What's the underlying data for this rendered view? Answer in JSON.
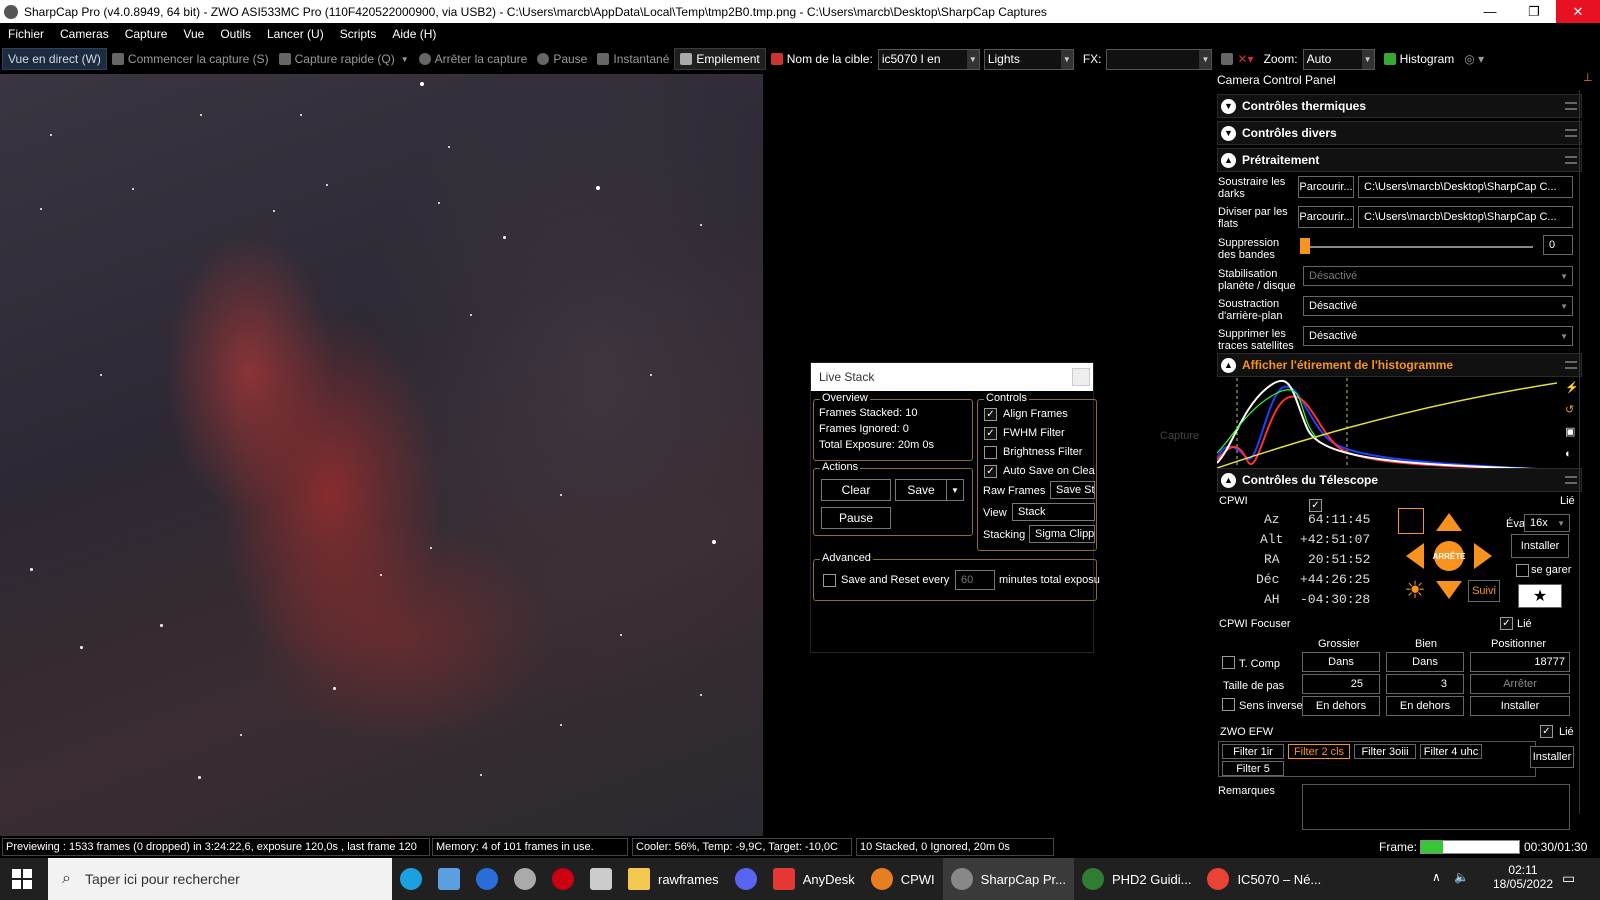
{
  "window": {
    "title": "SharpCap Pro (v4.0.8949, 64 bit) - ZWO ASI533MC Pro (110F420522000900, via USB2) - C:\\Users\\marcb\\AppData\\Local\\Temp\\tmp2B0.tmp.png - C:\\Users\\marcb\\Desktop\\SharpCap Captures",
    "minimize": "—",
    "maximize": "❐",
    "close": "✕"
  },
  "menu": [
    "Fichier",
    "Cameras",
    "Capture",
    "Vue",
    "Outils",
    "Lancer (U)",
    "Scripts",
    "Aide (H)"
  ],
  "toolbar": {
    "live_view": "Vue en direct (W)",
    "start_capture": "Commencer la capture (S)",
    "quick_capture": "Capture rapide (Q)",
    "stop_capture": "Arrêter la capture",
    "pause": "Pause",
    "snapshot": "Instantané",
    "stacking": "Empilement",
    "target_label": "Nom de la cible:",
    "target_value": "ic5070 I en",
    "frame_type": "Lights",
    "fx_label": "FX:",
    "zoom_label": "Zoom:",
    "zoom_value": "Auto",
    "histogram": "Histogram"
  },
  "live_stack": {
    "title": "Live Stack",
    "overview_label": "Overview",
    "frames_stacked": "Frames Stacked:  10",
    "frames_ignored": "Frames Ignored:  0",
    "total_exposure": "Total Exposure:   20m 0s",
    "actions_label": "Actions",
    "clear": "Clear",
    "save": "Save",
    "pause": "Pause",
    "controls_label": "Controls",
    "align_frames": "Align Frames",
    "fwhm_filter": "FWHM Filter",
    "brightness_filter": "Brightness Filter",
    "auto_save": "Auto Save on Clea",
    "raw_frames_label": "Raw Frames",
    "raw_frames_value": "Save St",
    "view_label": "View",
    "view_value": "Stack",
    "stacking_label": "Stacking",
    "stacking_value": "Sigma Clipp",
    "advanced_label": "Advanced",
    "save_reset": "Save and Reset every",
    "save_reset_minutes": "60",
    "save_reset_suffix": "minutes total exposu"
  },
  "panel": {
    "title": "Camera Control Panel",
    "thermal": "Contrôles thermiques",
    "misc": "Contrôles divers",
    "preprocessing": "Prétraitement",
    "subtract_darks": "Soustraire les darks",
    "divide_flats": "Diviser par les flats",
    "browse": "Parcourir...",
    "darks_path": "C:\\Users\\marcb\\Desktop\\SharpCap C...",
    "flats_path": "C:\\Users\\marcb\\Desktop\\SharpCap C...",
    "banding": "Suppression des bandes",
    "banding_value": "0",
    "stabilization": "Stabilisation planète / disque",
    "stabilization_value": "Désactivé",
    "bg_subtraction": "Soustraction d'arrière-plan",
    "bg_value": "Désactivé",
    "satellites": "Supprimer les traces satellites",
    "satellites_value": "Désactivé",
    "histogram_stretch": "Afficher l'étirement de l'histogramme",
    "histogram_overlay": "Capture",
    "telescope": "Contrôles du Télescope",
    "mount_name": "CPWI",
    "linked": "Lié",
    "az_label": "Az",
    "az_value": "64:11:45",
    "alt_label": "Alt",
    "alt_value": "+42:51:07",
    "ra_label": "RA",
    "ra_value": "20:51:52",
    "dec_label": "Déc",
    "dec_value": "+44:26:25",
    "ah_label": "AH",
    "ah_value": "-04:30:28",
    "stop_label": "ARRÊTE",
    "rate_label": "Évaluer:",
    "rate_value": "16x",
    "install": "Installer",
    "park": "se garer",
    "track": "Suivi",
    "focuser_name": "CPWI Focuser",
    "coarse": "Grossier",
    "fine": "Bien",
    "position": "Positionner",
    "tcomp": "T. Comp",
    "in": "Dans",
    "position_value": "18777",
    "step_size": "Taille de pas",
    "coarse_step": "25",
    "fine_step": "3",
    "stop": "Arrêter",
    "reverse": "Sens inverse",
    "out": "En dehors",
    "efw_name": "ZWO EFW",
    "filters": [
      "Filter 1ir",
      "Filter 2 cls",
      "Filter 3oiii",
      "Filter 4 uhc",
      "Filter 5"
    ],
    "active_filter_index": 1,
    "notes": "Remarques"
  },
  "histogram_curves": {
    "colors": {
      "white": "#ffffff",
      "red": "#ff3030",
      "blue": "#2040ff",
      "green": "#30ff30",
      "yellow": "#e0e040"
    }
  },
  "status": {
    "preview": "Previewing : 1533 frames (0 dropped) in 3:24:22,6, exposure 120,0s , last frame 120",
    "memory": "Memory: 4 of 101 frames in use.",
    "cooler": "Cooler: 56%, Temp: -9,9C, Target: -10,0C",
    "stack": "10 Stacked, 0 Ignored, 20m 0s",
    "frame_label": "Frame:",
    "frame_time": "00:30/01:30",
    "frame_progress": 0.22
  },
  "taskbar": {
    "search_placeholder": "Taper ici pour rechercher",
    "apps": [
      "rawframes",
      "AnyDesk",
      "CPWI",
      "SharpCap Pr...",
      "PHD2 Guidi...",
      "IC5070 – Né..."
    ],
    "time": "02:11",
    "date": "18/05/2022"
  },
  "colors": {
    "accent": "#f7931e",
    "groupbox": "#8a6d36",
    "live_view_bg": "#1c2b3e"
  }
}
